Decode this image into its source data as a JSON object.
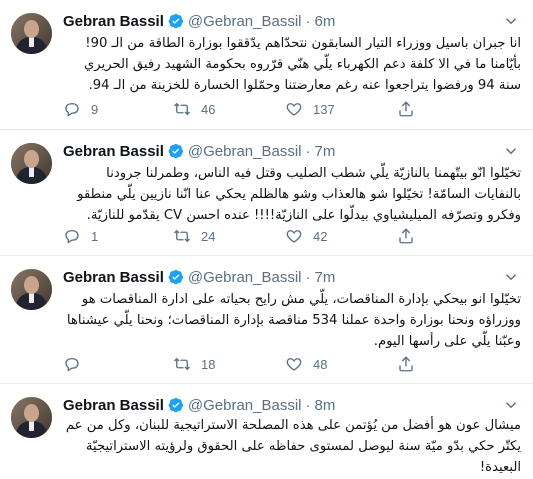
{
  "tweets": [
    {
      "name": "Gebran Bassil",
      "handle": "@Gebran_Bassil",
      "time": "6m",
      "text": "انا جبران باسيل ووزراء التيار السابقون نتحدّاهم يدّققوا بوزارة الطاقة من الـ 90! بأيّامنا ما في الا كلفة دعم الكهرباء يلّي هنّي قرّروه بحكومة الشهيد رفيق الحريري سنة 94 ورفضوا يتراجعوا عنه رغم معارضتنا وحمّلوا الخسارة للخزينة من الـ 94.",
      "replies": "9",
      "retweets": "46",
      "likes": "137"
    },
    {
      "name": "Gebran Bassil",
      "handle": "@Gebran_Bassil",
      "time": "7m",
      "text": "تخيّلوا انّو بيتّهمنا بالنازيّة يلّي شطب الصليب وقتل فيه الناس، وطمرلنا جرودنا بالنفايات السامّة! تخيّلوا شو هالعذاب وشو هالظلم يحكي عنا انّنا نازيين يلّي منطقو وفكرو وتصرّفه الميليشياوي بيدلّوا على النازيّة!!!! عنده احسن CV يقدّمو للنازيّة.",
      "replies": "1",
      "retweets": "24",
      "likes": "42"
    },
    {
      "name": "Gebran Bassil",
      "handle": "@Gebran_Bassil",
      "time": "7m",
      "text": "تخيّلوا انو بيحكي بإدارة المناقصات، يلّي مش رايح بحياته على ادارة المناقصات هو ووزراؤه ونحنا بوزارة واحدة عملنا 534 مناقصة بإدارة المناقصات؛ ونحنا يلّي عيشناها وعبّنا يلّي على رأسها اليوم.",
      "replies": "",
      "retweets": "18",
      "likes": "48"
    },
    {
      "name": "Gebran Bassil",
      "handle": "@Gebran_Bassil",
      "time": "8m",
      "text": "ميشال عون هو أفضل من يُؤتمن على هذه المصلحة الاستراتيجية للبنان، وكل من عم يكتّر حكي بدّو ميّة سنة ليوصل لمستوى حفاظه على الحقوق ولرؤيته الاستراتيجيّة البعيدة!"
    }
  ],
  "colors": {
    "verified": "#1da1f2",
    "muted": "#5b7083",
    "divider": "#e6ecf0"
  },
  "icons": {
    "reply": "reply-icon",
    "retweet": "retweet-icon",
    "like": "like-icon",
    "share": "share-icon",
    "more": "more-icon",
    "verified": "verified-badge-icon"
  }
}
